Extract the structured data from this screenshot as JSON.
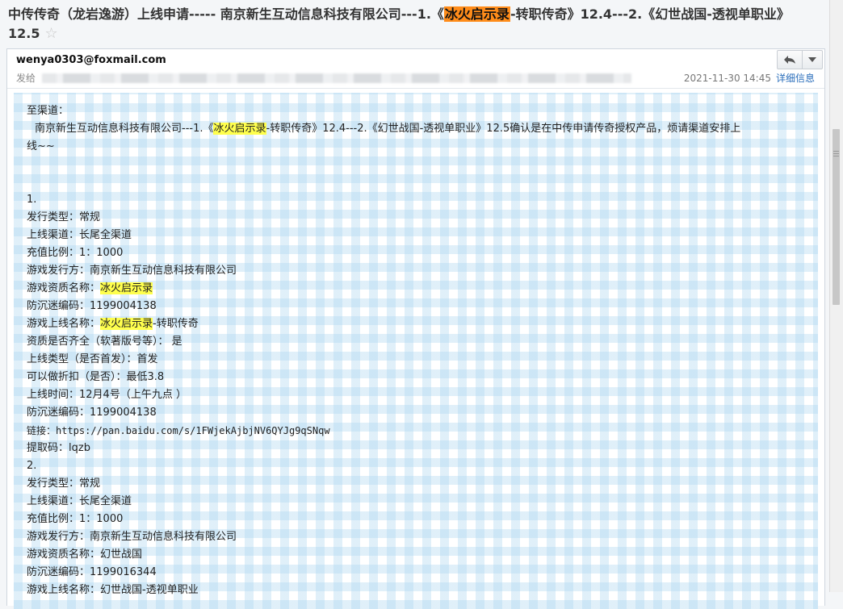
{
  "email": {
    "subject_parts": [
      {
        "text": "中传传奇（龙岩逸游）上线申请----- 南京新生互动信息科技有限公司---1.《",
        "hl": false
      },
      {
        "text": "冰火启示录",
        "hl": true
      },
      {
        "text": "-转职传奇》12.4---2.《幻世战国-透视单职业》12.5",
        "hl": false
      }
    ],
    "star_icon": "☆",
    "sender": "wenya0303@foxmail.com",
    "to_label": "发给",
    "datetime": "2021-11-30 14:45",
    "details_label": "详细信息",
    "reply_icon": "reply-icon",
    "more_icon": "chevron-down-icon"
  },
  "body": {
    "greeting": "至渠道：",
    "intro_parts": [
      {
        "text": "南京新生互动信息科技有限公司---1.《",
        "hl": false
      },
      {
        "text": "冰火启示录",
        "hl": true
      },
      {
        "text": "-转职传奇》12.4---2.《幻世战国-透视单职业》12.5确认是在中传申请传奇授权产品，烦请渠道安排上",
        "hl": false
      }
    ],
    "intro_tail": "线~~",
    "items": [
      {
        "parts": [
          {
            "text": "1.",
            "hl": false
          }
        ]
      },
      {
        "parts": [
          {
            "text": "发行类型：常规",
            "hl": false
          }
        ]
      },
      {
        "parts": [
          {
            "text": "上线渠道：长尾全渠道",
            "hl": false
          }
        ]
      },
      {
        "parts": [
          {
            "text": "充值比例：1：1000",
            "hl": false
          }
        ]
      },
      {
        "parts": [
          {
            "text": "游戏发行方：南京新生互动信息科技有限公司",
            "hl": false
          }
        ]
      },
      {
        "parts": [
          {
            "text": "游戏资质名称：",
            "hl": false
          },
          {
            "text": "冰火启示录",
            "hl": true
          }
        ]
      },
      {
        "parts": [
          {
            "text": "防沉迷编码：1199004138",
            "hl": false
          }
        ]
      },
      {
        "parts": [
          {
            "text": "游戏上线名称：",
            "hl": false
          },
          {
            "text": "冰火启示录",
            "hl": true
          },
          {
            "text": "-转职传奇",
            "hl": false
          }
        ]
      },
      {
        "parts": [
          {
            "text": "资质是否齐全（软著版号等）： 是",
            "hl": false
          }
        ]
      },
      {
        "parts": [
          {
            "text": "上线类型（是否首发）：首发",
            "hl": false
          }
        ]
      },
      {
        "parts": [
          {
            "text": "可以做折扣（是否）：最低3.8",
            "hl": false
          }
        ]
      },
      {
        "parts": [
          {
            "text": "上线时间：12月4号（上午九点 ）",
            "hl": false
          }
        ]
      },
      {
        "parts": [
          {
            "text": "防沉迷编码：1199004138",
            "hl": false
          }
        ]
      },
      {
        "parts": [
          {
            "text": "链接：https://pan.baidu.com/s/1FWjekAjbjNV6QYJg9qSNqw",
            "hl": false
          }
        ]
      },
      {
        "parts": [
          {
            "text": "提取码：lqzb",
            "hl": false
          }
        ]
      },
      {
        "parts": [
          {
            "text": "2.",
            "hl": false
          }
        ]
      },
      {
        "parts": [
          {
            "text": "发行类型：常规",
            "hl": false
          }
        ]
      },
      {
        "parts": [
          {
            "text": "上线渠道：长尾全渠道",
            "hl": false
          }
        ]
      },
      {
        "parts": [
          {
            "text": "充值比例：1：1000",
            "hl": false
          }
        ]
      },
      {
        "parts": [
          {
            "text": "游戏发行方：南京新生互动信息科技有限公司",
            "hl": false
          }
        ]
      },
      {
        "parts": [
          {
            "text": "游戏资质名称：幻世战国",
            "hl": false
          }
        ]
      },
      {
        "parts": [
          {
            "text": "防沉迷编码：1199016344",
            "hl": false
          }
        ]
      },
      {
        "parts": [
          {
            "text": "游戏上线名称：幻世战国-透视单职业",
            "hl": false
          }
        ]
      }
    ]
  },
  "colors": {
    "subject_highlight": "#ff8c1a",
    "body_highlight": "#ffff4d",
    "link": "#2a6ebb"
  }
}
